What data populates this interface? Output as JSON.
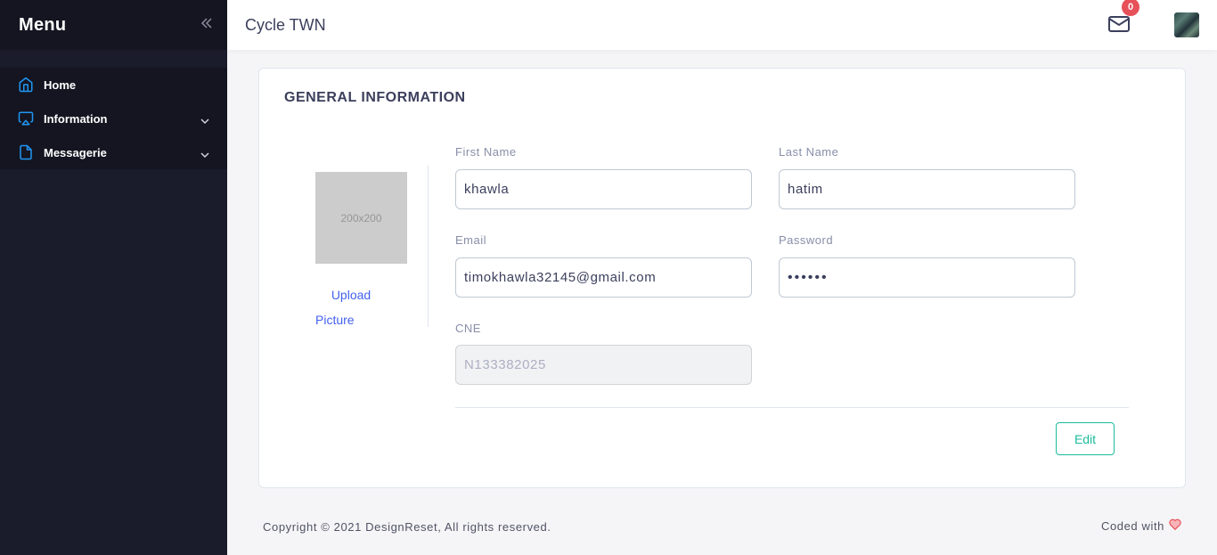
{
  "sidebar": {
    "title": "Menu",
    "items": [
      {
        "label": "Home",
        "icon": "home-icon"
      },
      {
        "label": "Information",
        "icon": "airplay-icon"
      },
      {
        "label": "Messagerie",
        "icon": "file-icon"
      }
    ]
  },
  "header": {
    "title": "Cycle TWN",
    "mail_badge": "0"
  },
  "card": {
    "title": "GENERAL INFORMATION",
    "photo_placeholder": "200x200",
    "upload_line1": "Upload",
    "upload_line2": "Picture",
    "fields": {
      "first_name": {
        "label": "First Name",
        "value": "khawla"
      },
      "last_name": {
        "label": "Last Name",
        "value": "hatim"
      },
      "email": {
        "label": "Email",
        "value": "timokhawla32145@gmail.com"
      },
      "password": {
        "label": "Password",
        "value": "••••••"
      },
      "cne": {
        "label": "CNE",
        "value": "N133382025"
      }
    },
    "edit_label": "Edit"
  },
  "footer": {
    "copyright": "Copyright © 2021 DesignReset, All rights reserved.",
    "coded_with": "Coded with"
  },
  "colors": {
    "sidebar_bg": "#1b1c2b",
    "accent_blue": "#4361ee",
    "accent_green": "#1abc9c",
    "badge_red": "#e7515a"
  }
}
